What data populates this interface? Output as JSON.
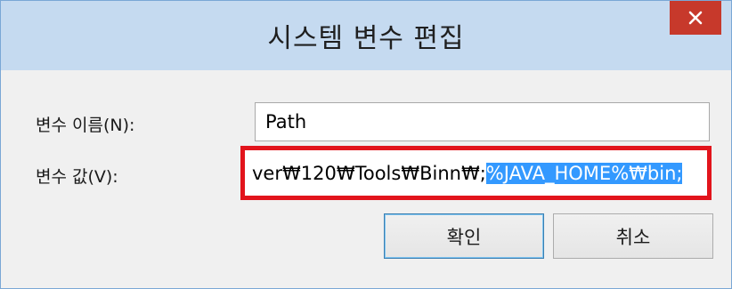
{
  "window": {
    "title": "시스템 변수 편집",
    "close_icon": "close-icon"
  },
  "form": {
    "name_label": "변수 이름(N):",
    "name_value": "Path",
    "value_label": "변수 값(V):",
    "value_visible_prefix": "ver₩120₩Tools₩Binn₩;",
    "value_selected": "%JAVA_HOME%₩bin;"
  },
  "buttons": {
    "ok_label": "확인",
    "cancel_label": "취소"
  },
  "colors": {
    "titlebar": "#c5daf0",
    "close_button": "#c7392b",
    "highlight_border": "#e2141c",
    "selection": "#3399ff"
  }
}
